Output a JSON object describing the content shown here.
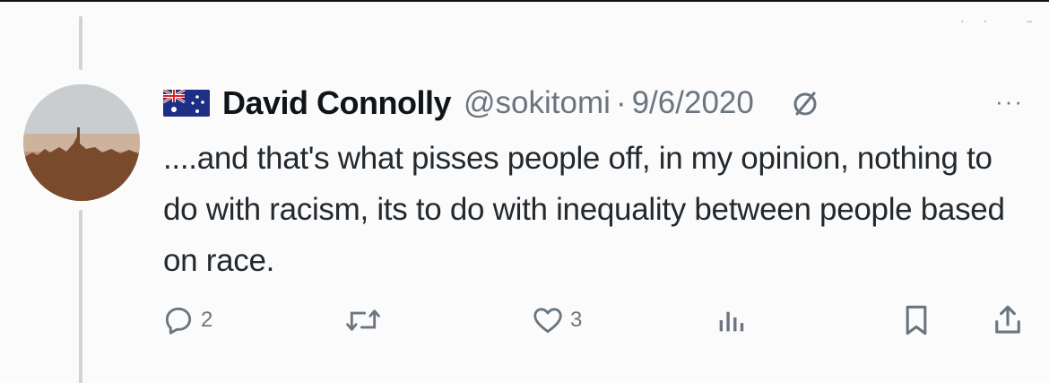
{
  "tweet": {
    "author_name": "David Connolly",
    "handle": "@sokitomi",
    "separator": "·",
    "date": "9/6/2020",
    "text": "....and that's what pisses people off, in my opinion, nothing to do with racism, its to do with inequality between people based on race.",
    "flag_icon": "australia-flag-icon"
  },
  "actions": {
    "reply_count": "2",
    "repost_count": "",
    "like_count": "3",
    "views_count": ""
  },
  "colors": {
    "text_primary": "#0f1419",
    "text_secondary": "#6b7580",
    "thread_line": "#cfd4d8"
  }
}
